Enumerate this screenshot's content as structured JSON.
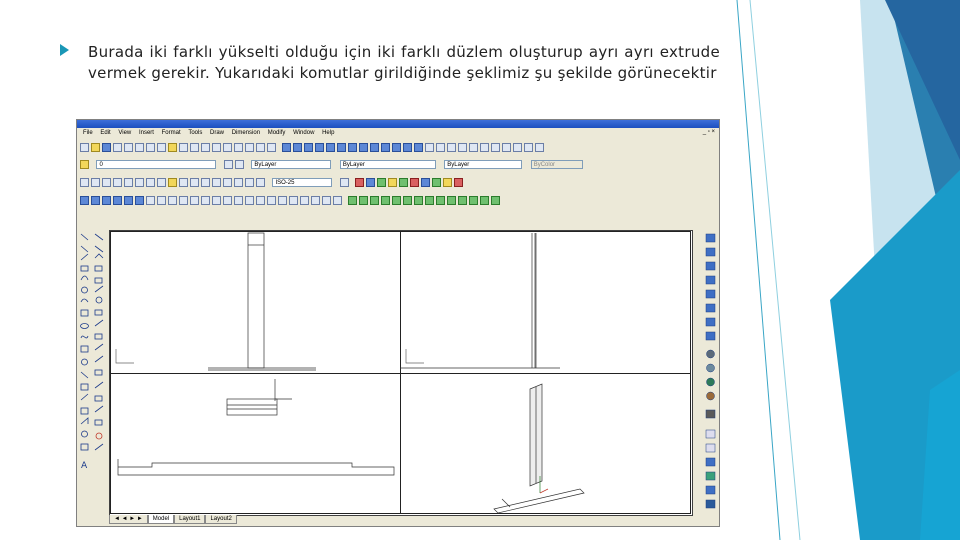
{
  "slide": {
    "bullet_text": "Burada iki farklı yükselti olduğu için iki farklı düzlem oluşturup ayrı ayrı extrude vermek gerekir. Yukarıdaki komutlar girildiğinde şeklimiz şu şekilde görünecektir",
    "accent_color": "#1a97b6"
  },
  "cad": {
    "menu": [
      "File",
      "Edit",
      "View",
      "Insert",
      "Format",
      "Tools",
      "Draw",
      "Dimension",
      "Modify",
      "Window",
      "Help"
    ],
    "layer_combo": "0",
    "linetype_combo_1": "ByLayer",
    "linetype_combo_2": "ByLayer",
    "linetype_combo_3": "ByLayer",
    "color_combo": "ByColor",
    "dimstyle_combo": "ISO-25",
    "tabs": [
      "Model",
      "Layout1",
      "Layout2"
    ]
  }
}
